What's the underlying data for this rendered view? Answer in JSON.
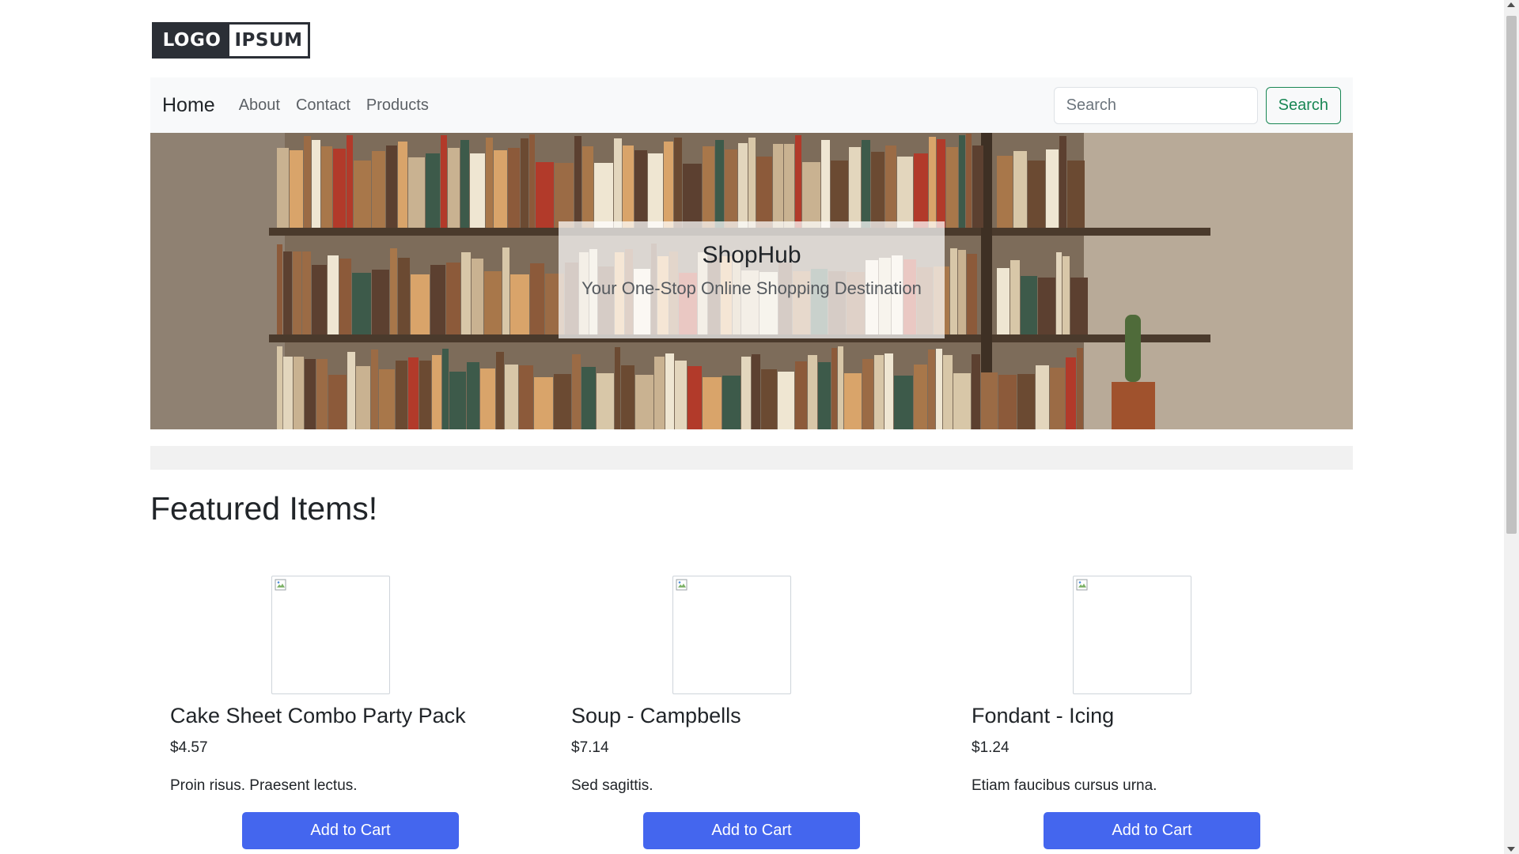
{
  "logo": {
    "part1": "LOGO",
    "part2": "IPSUM"
  },
  "nav": {
    "brand": "Home",
    "links": [
      "About",
      "Contact",
      "Products"
    ],
    "search_placeholder": "Search",
    "search_button": "Search"
  },
  "hero": {
    "title": "ShopHub",
    "subtitle": "Your One-Stop Online Shopping Destination"
  },
  "featured": {
    "heading": "Featured Items!",
    "products": [
      {
        "name": "Cake Sheet Combo Party Pack",
        "price": "$4.57",
        "description": "Proin risus. Praesent lectus.",
        "button": "Add to Cart"
      },
      {
        "name": "Soup - Campbells",
        "price": "$7.14",
        "description": "Sed sagittis.",
        "button": "Add to Cart"
      },
      {
        "name": "Fondant - Icing",
        "price": "$1.24",
        "description": "Etiam faucibus cursus urna.",
        "button": "Add to Cart"
      }
    ]
  },
  "colors": {
    "primary_button": "#4466ee",
    "search_outline": "#198754",
    "navbar_bg": "#f8f9fa"
  }
}
